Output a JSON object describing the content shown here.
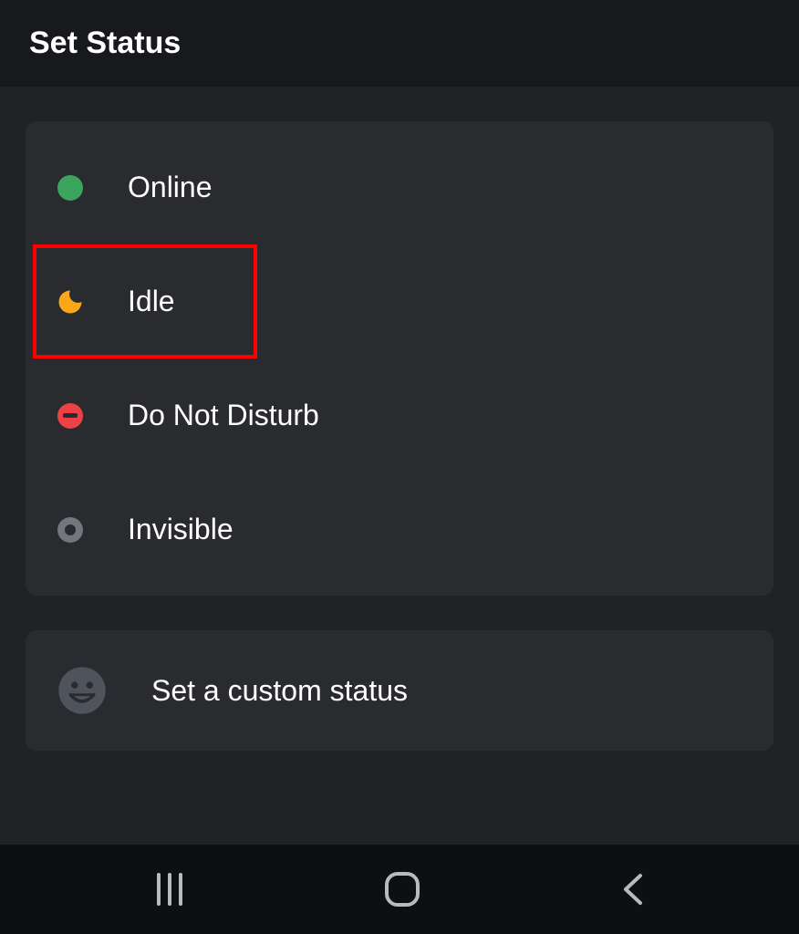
{
  "header": {
    "title": "Set Status"
  },
  "statuses": [
    {
      "label": "Online",
      "icon": "online"
    },
    {
      "label": "Idle",
      "icon": "idle",
      "highlighted": true
    },
    {
      "label": "Do Not Disturb",
      "icon": "dnd"
    },
    {
      "label": "Invisible",
      "icon": "invisible"
    }
  ],
  "customStatus": {
    "label": "Set a custom status"
  },
  "colors": {
    "online": "#3ba55d",
    "idle": "#faa81a",
    "dnd": "#ed4245",
    "invisible": "#72767d"
  }
}
